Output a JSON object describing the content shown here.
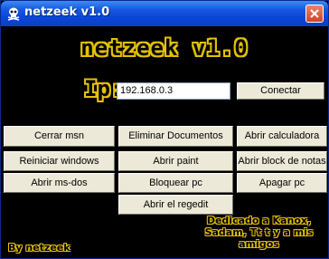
{
  "window": {
    "title": "netzeek v1.0",
    "icon": "skull-icon"
  },
  "header": {
    "logo_text": "netzeek v1.0"
  },
  "connection": {
    "ip_label": "Ip:",
    "ip_value": "192.168.0.3",
    "connect_label": "Conectar"
  },
  "buttons": {
    "cerrar_msn": "Cerrar msn",
    "eliminar_documentos": "Eliminar Documentos",
    "abrir_calculadora": "Abrir calculadora",
    "reiniciar_windows": "Reiniciar windows",
    "abrir_paint": "Abrir paint",
    "abrir_block_notas": "Abrir block de notas",
    "abrir_msdos": "Abrir ms-dos",
    "bloquear_pc": "Bloquear pc",
    "apagar_pc": "Apagar pc",
    "abrir_regedit": "Abrir el regedit"
  },
  "footer": {
    "author": "By netzeek",
    "dedication": "Dedicado a Kanox, Sadam, Tt t y a mis amigos"
  },
  "colors": {
    "accent": "#e5c200",
    "background": "#000000",
    "titlebar": "#0a46d8",
    "button_face": "#ece9d8"
  }
}
